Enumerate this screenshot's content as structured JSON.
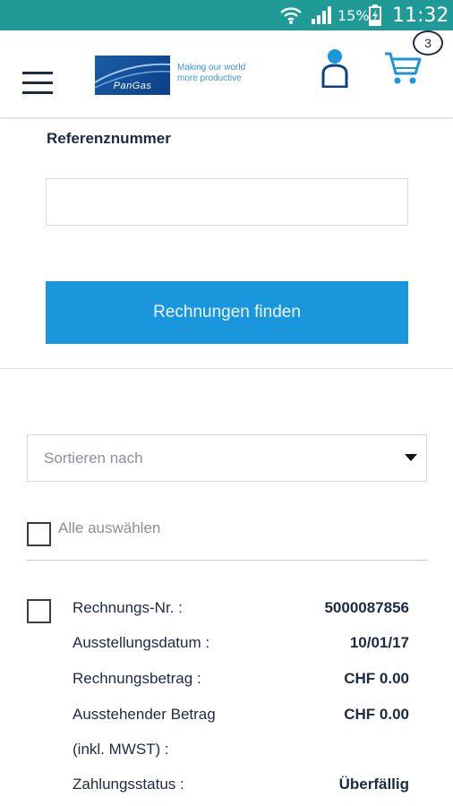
{
  "status_bar": {
    "wifi_icon": "wifi-icon",
    "signal_icon": "signal-icon",
    "battery_percent": "15%",
    "battery_icon": "battery-charging-icon",
    "time": "11:32"
  },
  "header": {
    "menu_icon": "hamburger-menu-icon",
    "logo_text": "PanGas",
    "tagline_line1": "Making our world",
    "tagline_line2": "more productive",
    "account_icon": "user-icon",
    "cart_icon": "cart-icon",
    "cart_count": "3"
  },
  "search": {
    "reference_label": "Referenznummer",
    "reference_value": "",
    "find_button_label": "Rechnungen finden"
  },
  "sort": {
    "placeholder": "Sortieren nach"
  },
  "select_all": {
    "label": "Alle auswählen",
    "checked": false
  },
  "invoices": [
    {
      "checked": false,
      "fields": [
        {
          "label": "Rechnungs-Nr. :",
          "value": "5000087856"
        },
        {
          "label": "Ausstellungsdatum :",
          "value": "10/01/17"
        },
        {
          "label": "Rechnungsbetrag :",
          "value": "CHF 0.00"
        },
        {
          "label": "Ausstehender Betrag",
          "value": "CHF 0.00"
        },
        {
          "label": "(inkl. MWST) :",
          "value": ""
        },
        {
          "label": "Zahlungsstatus :",
          "value": "Überfällig"
        }
      ]
    }
  ],
  "colors": {
    "status_bar": "#1f9a96",
    "primary_button": "#1a96dc",
    "brand_blue": "#0c3f86",
    "text_dark": "#1c2a44"
  }
}
